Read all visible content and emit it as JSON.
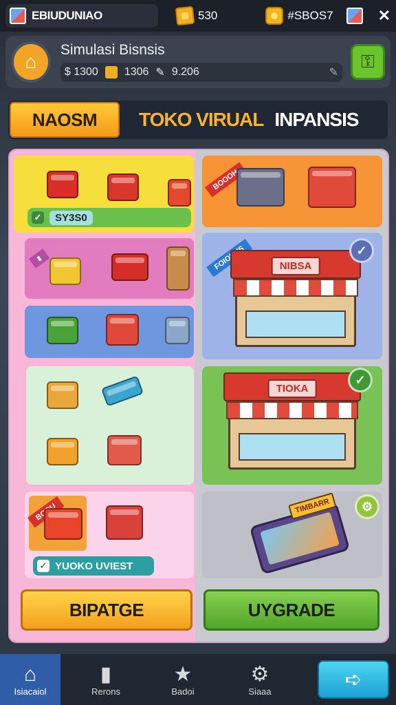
{
  "topbar": {
    "app_name": "EBIUDUNIAO",
    "coins": "530",
    "gems": "#SBOS7"
  },
  "header": {
    "title": "Simulasi Bisnsis",
    "stat1": "$ 1300",
    "stat2": "1306",
    "stat3": "9.206"
  },
  "tabs": {
    "active": "NAOSM",
    "virtual": "TOKO VIRUAL",
    "inpansis": "INPANSIS"
  },
  "cards": {
    "pill1": "SY3S0",
    "pill2": "YUOKO UVIEST",
    "ribbon_top_right": "BOOOH",
    "ribbon_shop1": "FOIORUS",
    "ribbon_bottom": "BOOU",
    "shop1_sign": "NIBSA",
    "shop2_sign": "TIOKA",
    "phone_tag": "TIMBARR"
  },
  "buttons": {
    "left": "BIPATGE",
    "right": "UYGRADE"
  },
  "nav": {
    "home": "Isiacaiol",
    "reports": "Rerons",
    "badges": "Badoi",
    "settings": "Siaaa"
  },
  "colors": {
    "accent_orange": "#f4a01c",
    "accent_green": "#52a52b",
    "board_pink": "#f8b6d8"
  }
}
